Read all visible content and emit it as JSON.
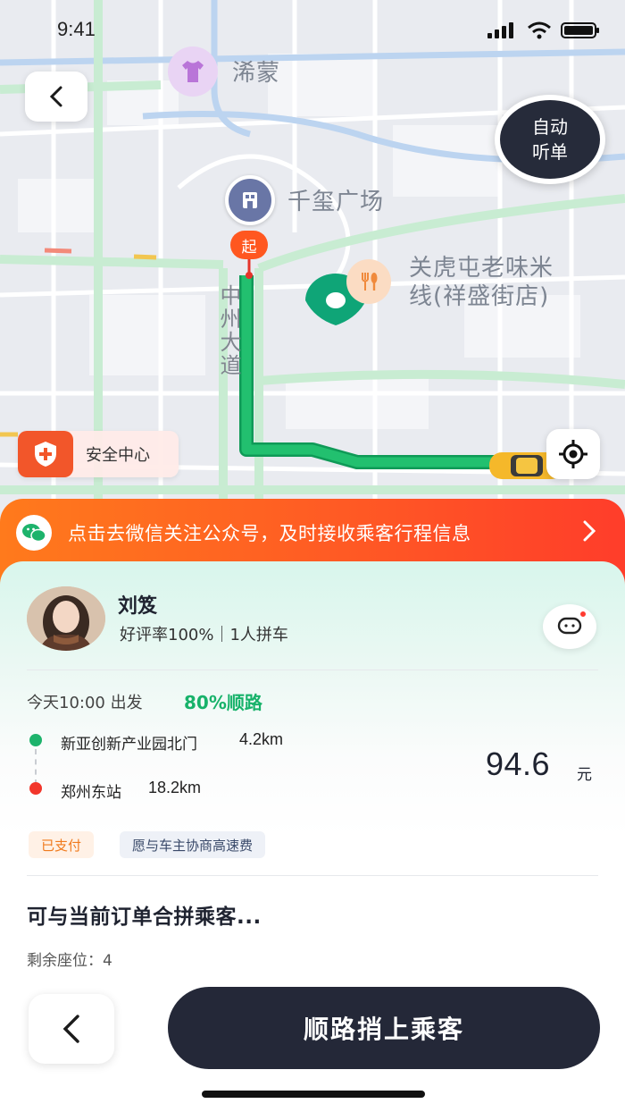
{
  "status_bar": {
    "time": "9:41"
  },
  "map": {
    "pois": [
      {
        "name": "浠蒙",
        "icon": "tshirt-icon",
        "icon_color": "#c58be0"
      },
      {
        "name": "千玺广场",
        "icon": "building-icon",
        "icon_color": "#6976a6"
      },
      {
        "name": "关虎屯老味米\n线(祥盛街店)",
        "icon": "fork-knife-icon",
        "icon_color": "#f4a56a"
      }
    ],
    "road_label": "中州大道",
    "start_marker": "起",
    "route_color": "#1db36c",
    "auto_listen": {
      "line1": "自动",
      "line2": "听单"
    },
    "safety_center": "安全中心"
  },
  "banner": {
    "text": "点击去微信关注公众号，及时接收乘客行程信息"
  },
  "passenger": {
    "name": "刘笈",
    "meta": "好评率100%｜1人拼车"
  },
  "trip": {
    "depart": "今天10:00 出发",
    "match_rate": "80%顺路",
    "stops": [
      {
        "name": "新亚创新产业园北门",
        "distance": "4.2km",
        "color": "#1db36c"
      },
      {
        "name": "郑州东站",
        "distance": "18.2km",
        "color": "#f2362b"
      }
    ],
    "fare": "94.6",
    "fare_unit": "元",
    "tags": [
      "已支付",
      "愿与车主协商高速费"
    ]
  },
  "section": {
    "title": "可与当前订单合拼乘客...",
    "seats": "剩余座位：4"
  },
  "actions": {
    "primary": "顺路捎上乘客"
  }
}
